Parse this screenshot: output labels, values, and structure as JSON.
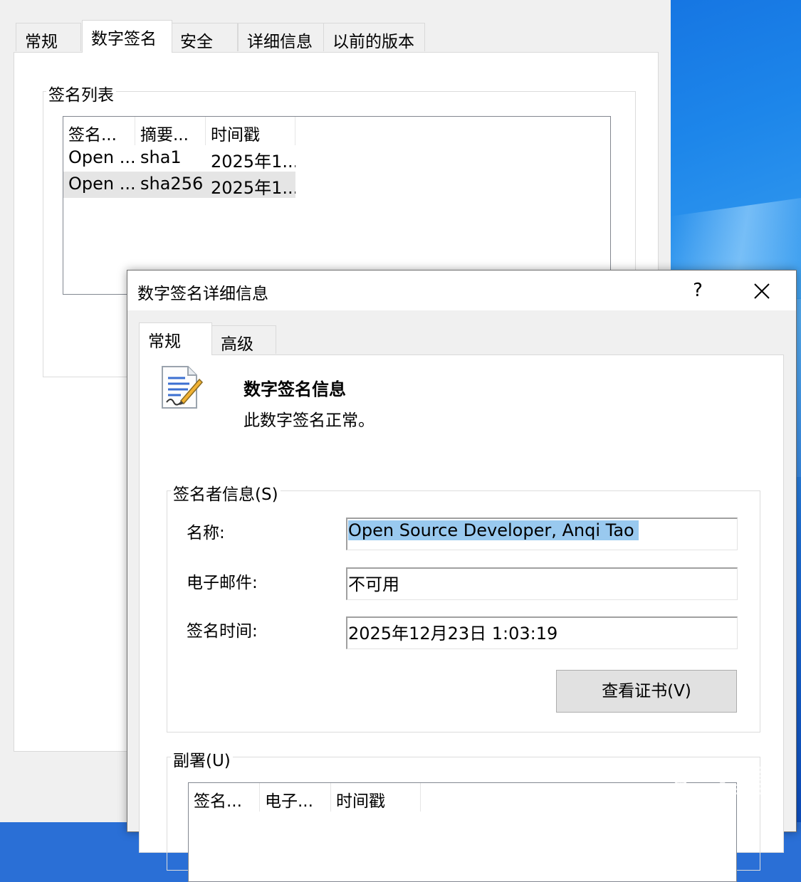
{
  "bg_window": {
    "tabs": [
      "常规",
      "数字签名",
      "安全",
      "详细信息",
      "以前的版本"
    ],
    "active_tab_index": 1,
    "signature_list": {
      "group_label": "签名列表",
      "columns": [
        "签名...",
        "摘要...",
        "时间戳"
      ],
      "rows": [
        [
          "Open ...",
          "sha1",
          "2025年1..."
        ],
        [
          "Open ...",
          "sha256",
          "2025年1..."
        ]
      ],
      "selected_row": 1
    }
  },
  "dialog": {
    "title": "数字签名详细信息",
    "help_label": "?",
    "close_label": "✕",
    "tabs": [
      "常规",
      "高级"
    ],
    "active_tab_index": 0,
    "info_heading": "数字签名信息",
    "info_status": "此数字签名正常。",
    "signer_group": {
      "label": "签名者信息(S)",
      "name_label": "名称:",
      "name_value": "Open Source Developer, Anqi Tao",
      "email_label": "电子邮件:",
      "email_value": "不可用",
      "time_label": "签名时间:",
      "time_value": "2025年12月23日 1:03:19",
      "view_cert_button": "查看证书(V)"
    },
    "countersign_group": {
      "label": "副署(U)",
      "columns": [
        "签名...",
        "电子...",
        "时间戳"
      ]
    }
  },
  "watermark": "看雪"
}
